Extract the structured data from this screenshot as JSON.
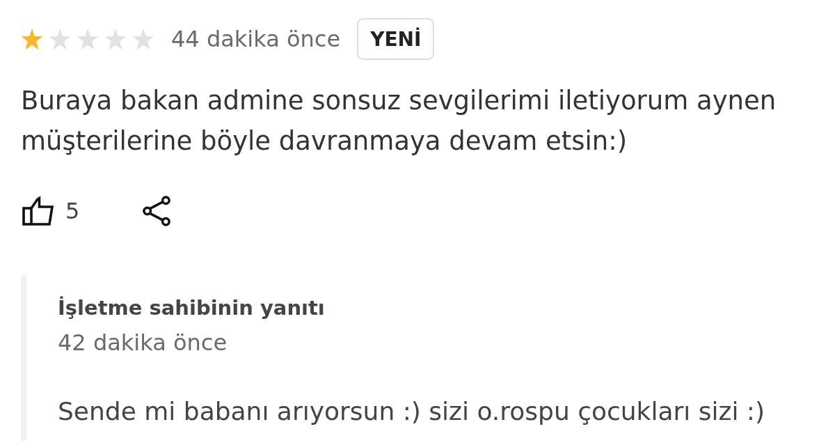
{
  "review": {
    "stars": 1,
    "time": "44 dakika önce",
    "badge": "YENİ",
    "text": "Buraya bakan admine sonsuz sevgilerimi iletiyorum aynen müşterilerine böyle davranmaya devam etsin:)",
    "likes": "5"
  },
  "owner_reply": {
    "title": "İşletme sahibinin yanıtı",
    "time": "42 dakika önce",
    "text": "Sende mi babanı arıyorsun :) sizi o.rospu çocukları sizi :)"
  }
}
